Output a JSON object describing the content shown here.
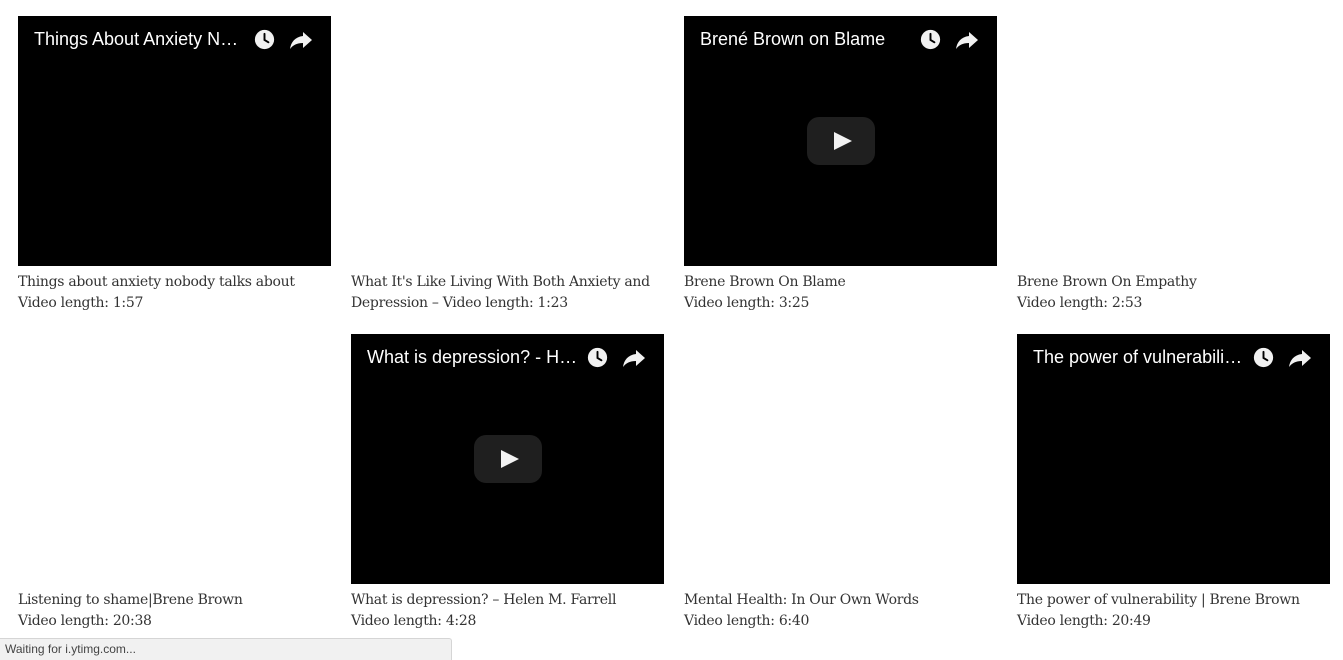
{
  "videos": [
    {
      "embed_title": "Things About Anxiety N…",
      "loaded": true,
      "show_play": false,
      "caption_title": "Things about anxiety nobody talks about",
      "caption_length": "Video length: 1:57"
    },
    {
      "embed_title": "",
      "loaded": false,
      "show_play": false,
      "caption_title": "What It's Like Living With Both Anxiety and",
      "caption_length": "Depression – Video length: 1:23"
    },
    {
      "embed_title": "Brené Brown on Blame",
      "loaded": true,
      "show_play": true,
      "caption_title": "Brene Brown On Blame",
      "caption_length": "Video length: 3:25"
    },
    {
      "embed_title": "",
      "loaded": false,
      "show_play": false,
      "caption_title": "Brene Brown On Empathy",
      "caption_length": "Video length: 2:53"
    },
    {
      "embed_title": "",
      "loaded": false,
      "show_play": false,
      "caption_title": "Listening to shame|Brene Brown",
      "caption_length": "Video length: 20:38"
    },
    {
      "embed_title": "What is depression? - He…",
      "loaded": true,
      "show_play": true,
      "caption_title": "What is depression? – Helen M. Farrell",
      "caption_length": "Video length: 4:28"
    },
    {
      "embed_title": "",
      "loaded": false,
      "show_play": false,
      "caption_title": "Mental Health: In Our Own Words",
      "caption_length": "Video length: 6:40"
    },
    {
      "embed_title": "The power of vulnerabili…",
      "loaded": true,
      "show_play": false,
      "caption_title": "The power of vulnerability | Brene Brown",
      "caption_length": "Video length: 20:49"
    }
  ],
  "icons": {
    "clock": "clock-icon",
    "share": "share-icon",
    "play": "play-icon"
  },
  "status_bar": {
    "text": "Waiting for i.ytimg.com..."
  },
  "colors": {
    "player_bg": "#000000",
    "caption_text": "#333333",
    "play_button_bg": "#212121"
  }
}
